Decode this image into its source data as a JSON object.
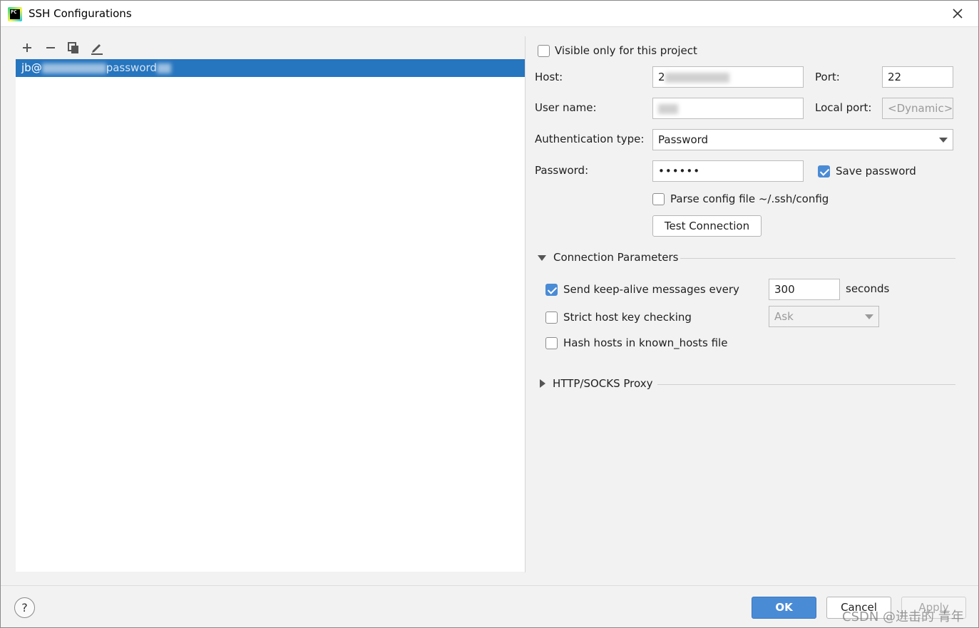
{
  "window": {
    "title": "SSH Configurations",
    "app_icon_text": "PC"
  },
  "toolbar": {
    "add_icon": "plus-icon",
    "remove_icon": "minus-icon",
    "copy_icon": "copy-icon",
    "edit_icon": "pencil-icon"
  },
  "list": {
    "items": [
      {
        "label_start": "jb@",
        "label_end": "password",
        "selected": true
      }
    ]
  },
  "form": {
    "visible_only_label": "Visible only for this project",
    "visible_only_checked": false,
    "host_label": "Host:",
    "host_value": "2",
    "port_label": "Port:",
    "port_value": "22",
    "user_label": "User name:",
    "user_value": "",
    "local_port_label": "Local port:",
    "local_port_placeholder": "<Dynamic>",
    "auth_label": "Authentication type:",
    "auth_value": "Password",
    "password_label": "Password:",
    "password_value": "••••••",
    "save_password_label": "Save password",
    "save_password_checked": true,
    "parse_config_label": "Parse config file ~/.ssh/config",
    "parse_config_checked": false,
    "test_connection_label": "Test Connection"
  },
  "connection_params": {
    "title": "Connection Parameters",
    "expanded": true,
    "keepalive_label": "Send keep-alive messages every",
    "keepalive_checked": true,
    "keepalive_value": "300",
    "keepalive_unit": "seconds",
    "strict_label": "Strict host key checking",
    "strict_checked": false,
    "strict_value": "Ask",
    "hash_label": "Hash hosts in known_hosts file",
    "hash_checked": false
  },
  "proxy": {
    "title": "HTTP/SOCKS Proxy",
    "expanded": false
  },
  "footer": {
    "help_label": "?",
    "ok_label": "OK",
    "cancel_label": "Cancel",
    "apply_label": "Apply"
  },
  "watermark": "CSDN @进击的 青年",
  "colors": {
    "accent": "#4a8bd6",
    "selection": "#2675bf"
  }
}
